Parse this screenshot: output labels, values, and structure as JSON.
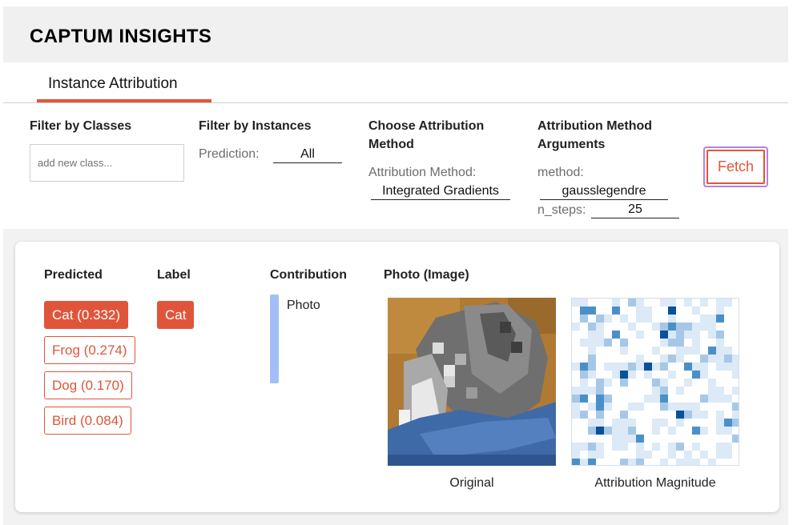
{
  "app": {
    "title": "CAPTUM INSIGHTS"
  },
  "tabs": [
    {
      "label": "Instance Attribution",
      "active": true
    }
  ],
  "filters": {
    "classes": {
      "heading": "Filter by Classes",
      "placeholder": "add new class..."
    },
    "instances": {
      "heading": "Filter by Instances",
      "prediction_label": "Prediction:",
      "prediction_value": "All"
    },
    "method": {
      "heading_line1": "Choose Attribution",
      "heading_line2": "Method",
      "label": "Attribution Method:",
      "value": "Integrated Gradients"
    },
    "arguments": {
      "heading_line1": "Attribution Method",
      "heading_line2": "Arguments",
      "method_label": "method:",
      "method_value": "gausslegendre",
      "steps_label": "n_steps:",
      "steps_value": "25"
    },
    "fetch_label": "Fetch"
  },
  "results": {
    "headers": {
      "predicted": "Predicted",
      "label": "Label",
      "contribution": "Contribution",
      "photo": "Photo (Image)"
    },
    "predicted": [
      {
        "text": "Cat (0.332)",
        "selected": true
      },
      {
        "text": "Frog (0.274)",
        "selected": false
      },
      {
        "text": "Dog (0.170)",
        "selected": false
      },
      {
        "text": "Bird (0.084)",
        "selected": false
      }
    ],
    "label": "Cat",
    "contribution": {
      "feature": "Photo"
    },
    "images": {
      "original_caption": "Original",
      "attribution_caption": "Attribution Magnitude"
    }
  },
  "colors": {
    "accent": "#e0553a",
    "focus_ring": "#b583d9",
    "contribution_bar": "#a3bef7",
    "attribution_blue": "#08519c"
  }
}
